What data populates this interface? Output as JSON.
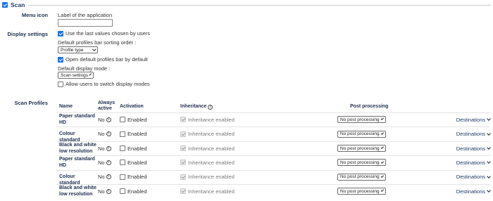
{
  "section": {
    "title": "Scan",
    "checked": true
  },
  "menu_icon": {
    "label": "Menu icon",
    "field_label": "Label of the application",
    "value": ""
  },
  "display_settings": {
    "label": "Display settings",
    "use_last_values": "Use the last values chosen by users",
    "use_last_values_checked": true,
    "sort_order_label": "Default profiles bar sorting order :",
    "sort_order_value": "Profile type",
    "open_profiles_bar": "Open default profiles bar by default",
    "open_profiles_bar_checked": true,
    "display_mode_label": "Default display mode :",
    "display_mode_value": "Scan settings",
    "allow_switch": "Allow users to switch display modes",
    "allow_switch_checked": false
  },
  "scan_profiles": {
    "label": "Scan Profiles",
    "columns": {
      "name": "Name",
      "always_active_line1": "Always",
      "always_active_line2": "active",
      "activation": "Activation",
      "inheritance": "Inheritance",
      "post_processing": "Post processing"
    },
    "rows": [
      {
        "name_line1": "Paper standard",
        "name_line2": "HD",
        "always_active": "No",
        "activation": "Enabled",
        "inheritance": "Inheritance enabled",
        "post_processing": "No post processing",
        "destinations": "Destinations"
      },
      {
        "name_line1": "Colour standard",
        "name_line2": "",
        "always_active": "No",
        "activation": "Enabled",
        "inheritance": "Inheritance enabled",
        "post_processing": "No post processing",
        "destinations": "Destinations"
      },
      {
        "name_line1": "Black and white",
        "name_line2": "low resolution",
        "always_active": "No",
        "activation": "Enabled",
        "inheritance": "Inheritance enabled",
        "post_processing": "No post processing",
        "destinations": "Destinations"
      },
      {
        "name_line1": "Paper standard",
        "name_line2": "HD",
        "always_active": "No",
        "activation": "Enabled",
        "inheritance": "Inheritance enabled",
        "post_processing": "No post processing",
        "destinations": "Destinations"
      },
      {
        "name_line1": "Colour standard",
        "name_line2": "",
        "always_active": "No",
        "activation": "Enabled",
        "inheritance": "Inheritance enabled",
        "post_processing": "No post processing",
        "destinations": "Destinations"
      },
      {
        "name_line1": "Black and white",
        "name_line2": "low resolution",
        "always_active": "No",
        "activation": "Enabled",
        "inheritance": "Inheritance enabled",
        "post_processing": "No post processing",
        "destinations": "Destinations"
      }
    ]
  },
  "colors": {
    "accent": "#1a73e8",
    "heading": "#1f3a66"
  }
}
